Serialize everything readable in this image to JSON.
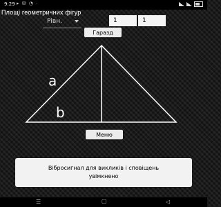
{
  "status_bar": {
    "time": "9:29",
    "notification_icons": "▸ ✉ ◔ ⋅"
  },
  "app": {
    "title": "Площі геометричних фігур"
  },
  "controls": {
    "shape_select_value": "Рівн.",
    "input_a_value": "1",
    "input_b_value": "1",
    "ok_button": "Гаразд",
    "menu_button": "Меню"
  },
  "figure": {
    "label_a": "a",
    "label_b": "b"
  },
  "toast": {
    "line1": "Вібросигнал для викликів і сповіщень",
    "line2": "увімкнено"
  },
  "nav_bar": {
    "recents_icon": "menu-icon",
    "home_icon": "home-icon",
    "back_icon": "back-icon"
  }
}
